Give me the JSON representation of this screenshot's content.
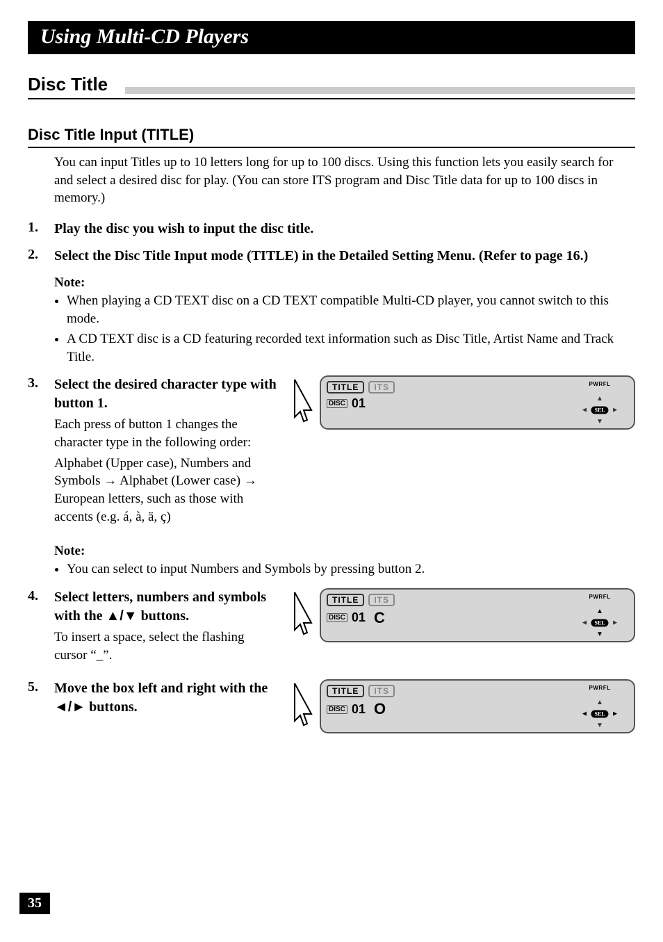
{
  "header": {
    "chapter_title": "Using Multi-CD Players"
  },
  "section": {
    "title": "Disc Title"
  },
  "subsection": {
    "title": "Disc Title Input (TITLE)",
    "intro": "You can input Titles up to 10 letters long for up to 100 discs. Using this function lets you easily search for and select a desired disc for play. (You can store ITS program and Disc Title data for up to 100 discs in memory.)"
  },
  "steps": {
    "s1": {
      "num": "1.",
      "head": "Play the disc you wish to input the disc title."
    },
    "s2": {
      "num": "2.",
      "head": "Select the Disc Title Input mode (TITLE) in the Detailed Setting Menu. (Refer to page 16.)"
    },
    "s3": {
      "num": "3.",
      "head": "Select the desired character type with button 1.",
      "detail_a": "Each press of button 1 changes the character type in the following order:",
      "detail_b_pre": "Alphabet (Upper case), Numbers and Symbols ",
      "detail_b_mid": " Alphabet (Lower case) ",
      "detail_b_post": " European letters, such as those with accents (e.g. á, à, ä, ç)"
    },
    "s4": {
      "num": "4.",
      "head_pre": "Select letters, numbers and symbols with the ",
      "head_post": " buttons.",
      "detail": "To insert a space, select the flashing cursor “_”."
    },
    "s5": {
      "num": "5.",
      "head_pre": "Move the box left and right with the ",
      "head_post": " buttons."
    }
  },
  "notes": {
    "label1": "Note:",
    "n1a": "When playing a CD TEXT disc on a CD TEXT compatible Multi-CD player, you cannot switch to this mode.",
    "n1b": "A CD TEXT disc is a CD featuring recorded text information such as Disc Title, Artist Name and Track Title.",
    "label2": "Note:",
    "n2a": "You can select to input Numbers and Symbols by pressing button 2."
  },
  "display": {
    "title_label": "TITLE",
    "its_label": "ITS",
    "disc_label": "DISC",
    "disc_num": "01",
    "pwr": "PWRFL",
    "sel": "SEL",
    "char3": "",
    "char4": "C",
    "char5": "O"
  },
  "symbols": {
    "up_down": "▲/▼",
    "left_right": "◄/►",
    "right_arrow": "→"
  },
  "page_number": "35"
}
